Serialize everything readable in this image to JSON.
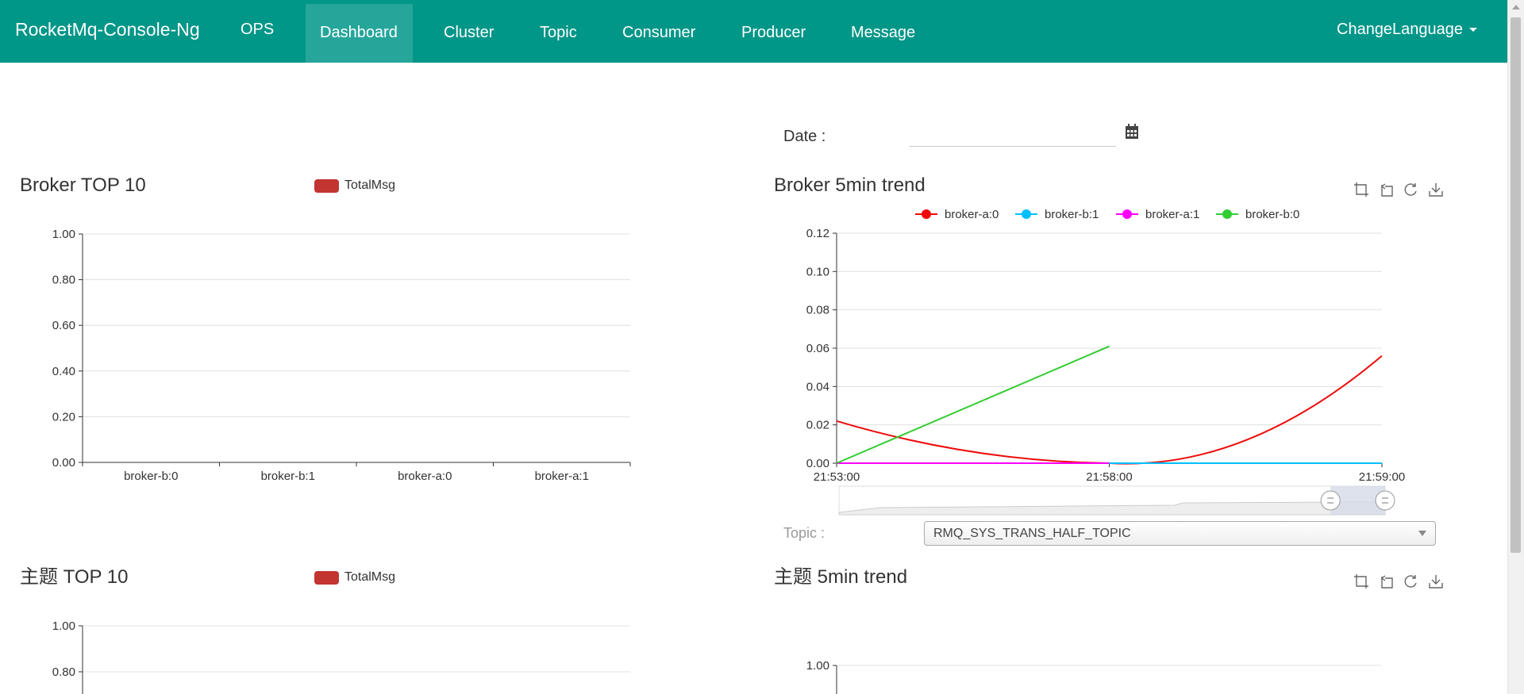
{
  "navbar": {
    "brand": "RocketMq-Console-Ng",
    "items": [
      {
        "label": "OPS"
      },
      {
        "label": "Dashboard"
      },
      {
        "label": "Cluster"
      },
      {
        "label": "Topic"
      },
      {
        "label": "Consumer"
      },
      {
        "label": "Producer"
      },
      {
        "label": "Message"
      }
    ],
    "active_item": "Dashboard",
    "language_label": "ChangeLanguage"
  },
  "colors": {
    "navbar": "#009688",
    "navbar_active": "#26a69a",
    "totalmsg": "#c23531",
    "broker_a0": "#ee0a0a",
    "broker_b1": "#00bfff",
    "broker_a1": "#ff00ff",
    "broker_b0": "#32cd32"
  },
  "date_filter": {
    "label": "Date :",
    "value": "",
    "icon": "calendar-icon"
  },
  "topic_filter": {
    "label": "Topic :",
    "selected": "RMQ_SYS_TRANS_HALF_TOPIC"
  },
  "toolbox": {
    "icons": [
      "zoom-icon",
      "zoom-reset-icon",
      "restore-icon",
      "save-image-icon"
    ]
  },
  "panels": {
    "broker_top": {
      "title": "Broker TOP 10",
      "legend": "TotalMsg"
    },
    "broker_trend": {
      "title": "Broker 5min trend"
    },
    "topic_top": {
      "title": "主题 TOP 10",
      "legend": "TotalMsg"
    },
    "topic_trend": {
      "title": "主题 5min trend"
    }
  },
  "chart_data": [
    {
      "id": "broker_top10",
      "type": "bar",
      "title": "Broker TOP 10",
      "legend": [
        "TotalMsg"
      ],
      "categories": [
        "broker-b:0",
        "broker-b:1",
        "broker-a:0",
        "broker-a:1"
      ],
      "series": [
        {
          "name": "TotalMsg",
          "values": [
            0,
            0,
            0,
            0
          ]
        }
      ],
      "ylim": [
        0,
        1
      ],
      "yticks": [
        "0.00",
        "0.20",
        "0.40",
        "0.60",
        "0.80",
        "1.00"
      ],
      "grid": true
    },
    {
      "id": "broker_trend",
      "type": "line",
      "title": "Broker 5min trend",
      "legend_position": "top",
      "x": [
        "21:53:00",
        "21:58:00",
        "21:59:00"
      ],
      "ylim": [
        0,
        0.12
      ],
      "yticks": [
        "0.00",
        "0.02",
        "0.04",
        "0.06",
        "0.08",
        "0.10",
        "0.12"
      ],
      "grid": true,
      "series": [
        {
          "name": "broker-a:0",
          "values": [
            0.022,
            0,
            0.056
          ]
        },
        {
          "name": "broker-b:1",
          "values": [
            0,
            0,
            0
          ]
        },
        {
          "name": "broker-a:1",
          "values": [
            0,
            0,
            null
          ]
        },
        {
          "name": "broker-b:0",
          "values": [
            0,
            0.061,
            null
          ]
        }
      ],
      "datazoom": {
        "start": 0.9,
        "end": 1.0
      }
    },
    {
      "id": "topic_top10",
      "type": "bar",
      "title": "主题 TOP 10",
      "legend": [
        "TotalMsg"
      ],
      "ylim": [
        0,
        1
      ],
      "yticks_visible": [
        "1.00",
        "0.80"
      ],
      "grid": true
    },
    {
      "id": "topic_trend",
      "type": "line",
      "title": "主题 5min trend",
      "yticks_visible": [
        "1.00"
      ],
      "grid": true
    }
  ]
}
